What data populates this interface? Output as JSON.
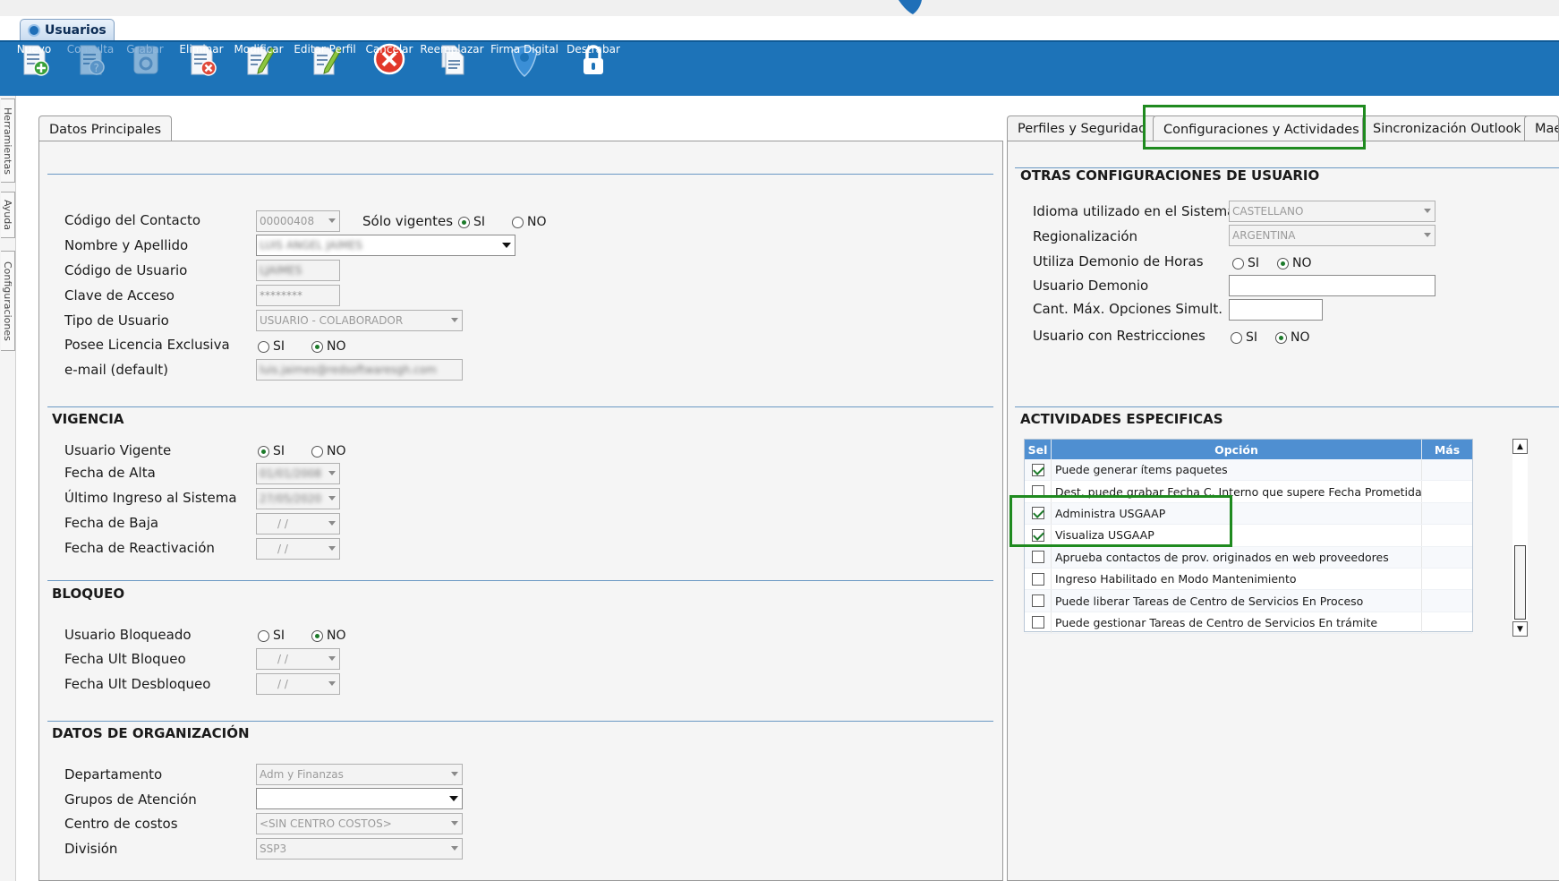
{
  "window": {
    "tab_title": "Usuarios"
  },
  "toolbar": {
    "buttons": [
      {
        "label": "Nuevo",
        "icon": "new-doc-icon",
        "enabled": true
      },
      {
        "label": "Consulta",
        "icon": "query-doc-icon",
        "enabled": false
      },
      {
        "label": "Grabar",
        "icon": "save-disk-icon",
        "enabled": false
      },
      {
        "label": "Eliminar",
        "icon": "delete-doc-icon",
        "enabled": true
      },
      {
        "label": "Modificar",
        "icon": "edit-doc-icon",
        "enabled": true
      },
      {
        "label": "Editar Perfil",
        "icon": "edit-profile-icon",
        "enabled": true
      },
      {
        "label": "Cancelar",
        "icon": "cancel-icon",
        "enabled": true
      },
      {
        "label": "Reemplazar",
        "icon": "replace-icon",
        "enabled": true
      },
      {
        "label": "Firma Digital",
        "icon": "digital-signature-icon",
        "enabled": true
      },
      {
        "label": "Destrabar",
        "icon": "unlock-icon",
        "enabled": true
      }
    ]
  },
  "side_tabs": [
    "Herramientas",
    "Ayuda",
    "Configuraciones"
  ],
  "left_panel": {
    "tab": "Datos Principales",
    "general": {
      "codigo_contacto": {
        "label": "Código del Contacto",
        "value": "00000408"
      },
      "solo_vigentes": {
        "label": "Sólo vigentes",
        "si": "SI",
        "no": "NO",
        "selected": "SI"
      },
      "nombre": {
        "label": "Nombre y Apellido",
        "value": "LUIS ANGEL JAIMES"
      },
      "codigo_usuario": {
        "label": "Código de Usuario",
        "value": "LJAIMES"
      },
      "clave": {
        "label": "Clave de Acceso",
        "value": "********"
      },
      "tipo_usuario": {
        "label": "Tipo de Usuario",
        "value": "USUARIO - COLABORADOR"
      },
      "licencia": {
        "label": "Posee Licencia Exclusiva",
        "si": "SI",
        "no": "NO",
        "selected": "NO"
      },
      "email": {
        "label": "e-mail (default)",
        "value": "luis.jaimes@redsoftwaresgh.com"
      }
    },
    "vigencia": {
      "title": "VIGENCIA",
      "usuario_vigente": {
        "label": "Usuario Vigente",
        "si": "SI",
        "no": "NO",
        "selected": "SI"
      },
      "fecha_alta": {
        "label": "Fecha de Alta",
        "value": "01/01/2008"
      },
      "ultimo_ingreso": {
        "label": "Último Ingreso al Sistema",
        "value": "27/05/2020"
      },
      "fecha_baja": {
        "label": "Fecha de Baja",
        "value": " / / "
      },
      "fecha_reactivacion": {
        "label": "Fecha de Reactivación",
        "value": " / / "
      }
    },
    "bloqueo": {
      "title": "BLOQUEO",
      "usuario_bloqueado": {
        "label": "Usuario Bloqueado",
        "si": "SI",
        "no": "NO",
        "selected": "NO"
      },
      "fecha_ult_bloqueo": {
        "label": "Fecha Ult Bloqueo",
        "value": " / / "
      },
      "fecha_ult_desbloqueo": {
        "label": "Fecha Ult Desbloqueo",
        "value": " / / "
      }
    },
    "organizacion": {
      "title": "DATOS DE ORGANIZACIÓN",
      "departamento": {
        "label": "Departamento",
        "value": "Adm y Finanzas"
      },
      "grupos": {
        "label": "Grupos de Atención",
        "value": ""
      },
      "centro_costos": {
        "label": "Centro de costos",
        "value": "<SIN CENTRO COSTOS>"
      },
      "division": {
        "label": "División",
        "value": "SSP3"
      }
    }
  },
  "right_panel": {
    "tabs": [
      "Perfiles y Seguridad",
      "Configuraciones y Actividades",
      "Sincronización Outlook",
      "Mae"
    ],
    "active_tab": "Configuraciones y Actividades",
    "otras": {
      "title": "OTRAS CONFIGURACIONES DE USUARIO",
      "idioma": {
        "label": "Idioma utilizado en el Sistema",
        "value": "CASTELLANO"
      },
      "regionalizacion": {
        "label": "Regionalización",
        "value": "ARGENTINA"
      },
      "demonio_horas": {
        "label": "Utiliza Demonio de Horas",
        "si": "SI",
        "no": "NO",
        "selected": "NO"
      },
      "usuario_demonio": {
        "label": "Usuario Demonio",
        "value": ""
      },
      "cant_max": {
        "label": "Cant. Máx. Opciones Simult.",
        "value": ""
      },
      "restricciones": {
        "label": "Usuario con Restricciones",
        "si": "SI",
        "no": "NO",
        "selected": "NO"
      }
    },
    "actividades": {
      "title": "ACTIVIDADES ESPECIFICAS",
      "columns": [
        "Sel",
        "Opción",
        "Más"
      ],
      "rows": [
        {
          "checked": true,
          "option": "Puede generar ítems paquetes"
        },
        {
          "checked": false,
          "option": "Dest. puede grabar Fecha C. Interno que supere Fecha Prometida"
        },
        {
          "checked": true,
          "option": "Administra USGAAP"
        },
        {
          "checked": true,
          "option": "Visualiza USGAAP"
        },
        {
          "checked": false,
          "option": "Aprueba contactos de prov. originados en web proveedores"
        },
        {
          "checked": false,
          "option": "Ingreso Habilitado en Modo Mantenimiento"
        },
        {
          "checked": false,
          "option": "Puede liberar Tareas de Centro de Servicios En Proceso"
        },
        {
          "checked": false,
          "option": "Puede gestionar Tareas de Centro de Servicios En trámite"
        }
      ]
    }
  },
  "colors": {
    "toolbar_bg": "#1d73b8",
    "highlight": "#1f8a1f",
    "grid_header": "#4f8fd1",
    "check": "#1c7a2a"
  }
}
